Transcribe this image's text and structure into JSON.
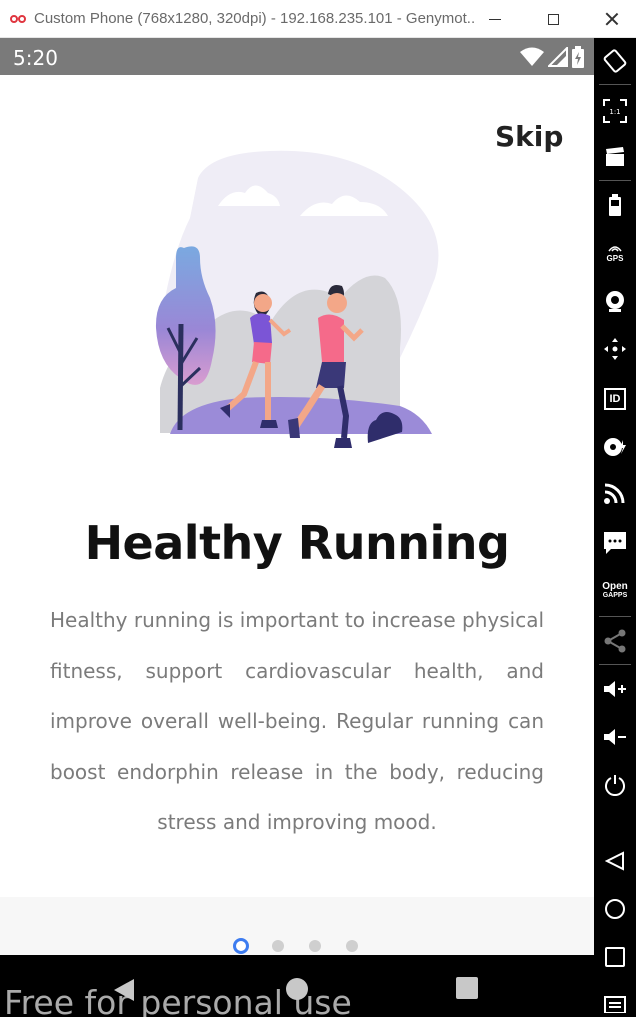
{
  "window": {
    "title": "Custom Phone (768x1280, 320dpi) - 192.168.235.101 - Genymot..."
  },
  "statusbar": {
    "time": "5:20"
  },
  "onboarding": {
    "skip_label": "Skip",
    "title": "Healthy Running",
    "description": "Healthy running is important to increase physical fitness, support cardiovascular health, and improve overall well-being. Regular running can boost endorphin release in the body, reducing stress and improving mood.",
    "page_count": 4,
    "current_page": 1
  },
  "colors": {
    "accent": "#3d7cf0",
    "statusbar": "#7a7a7a",
    "illustration_purple": "#9b8bd8",
    "illustration_pink": "#f56a8a"
  },
  "overlay": {
    "watermark": "Free for personal use"
  },
  "sidebar": {
    "icons": [
      "rotate-icon",
      "fullscreen-icon",
      "capture-icon",
      "battery-icon",
      "gps-icon",
      "camera-icon",
      "move-icon",
      "identifiers-icon",
      "media-icon",
      "network-icon",
      "sms-icon",
      "opengapps-icon",
      "share-icon",
      "volume-up-icon",
      "volume-down-icon",
      "power-icon",
      "back-icon",
      "home-icon",
      "recents-icon",
      "menu-icon"
    ],
    "gps_label": "GPS",
    "id_label": "ID",
    "open_label": "Open",
    "gapps_label": "GAPPS"
  }
}
